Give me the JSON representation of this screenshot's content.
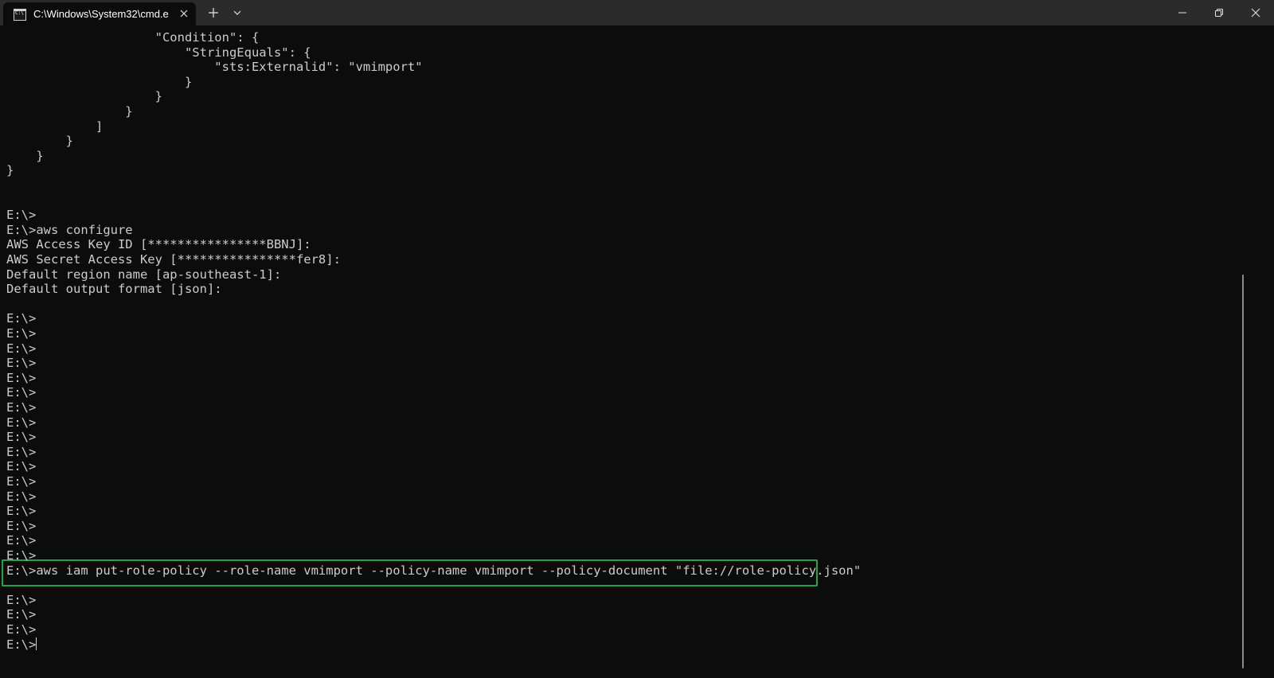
{
  "titlebar": {
    "tab_title": "C:\\Windows\\System32\\cmd.e"
  },
  "icons": {
    "tab": "cmd-icon",
    "close_tab": "close-icon",
    "new_tab": "plus-icon",
    "dropdown": "chevron-down-icon",
    "minimize": "minimize-icon",
    "maximize": "restore-icon",
    "close_window": "close-icon"
  },
  "colors": {
    "terminal_bg": "#0c0c0c",
    "text": "#cccccc",
    "highlight": "#22a447"
  },
  "terminal": {
    "lines": [
      "                    \"Condition\": {",
      "                        \"StringEquals\": {",
      "                            \"sts:Externalid\": \"vmimport\"",
      "                        }",
      "                    }",
      "                }",
      "            ]",
      "        }",
      "    }",
      "}",
      "",
      "",
      "E:\\>",
      "E:\\>aws configure",
      "AWS Access Key ID [****************BBNJ]:",
      "AWS Secret Access Key [****************fer8]:",
      "Default region name [ap-southeast-1]:",
      "Default output format [json]:",
      "",
      "E:\\>",
      "E:\\>",
      "E:\\>",
      "E:\\>",
      "E:\\>",
      "E:\\>",
      "E:\\>",
      "E:\\>",
      "E:\\>",
      "E:\\>",
      "E:\\>",
      "E:\\>",
      "E:\\>",
      "E:\\>",
      "E:\\>",
      "E:\\>",
      "E:\\>",
      "E:\\>aws iam put-role-policy --role-name vmimport --policy-name vmimport --policy-document \"file://role-policy.json\"",
      "",
      "E:\\>",
      "E:\\>",
      "E:\\>",
      "E:\\>"
    ]
  }
}
